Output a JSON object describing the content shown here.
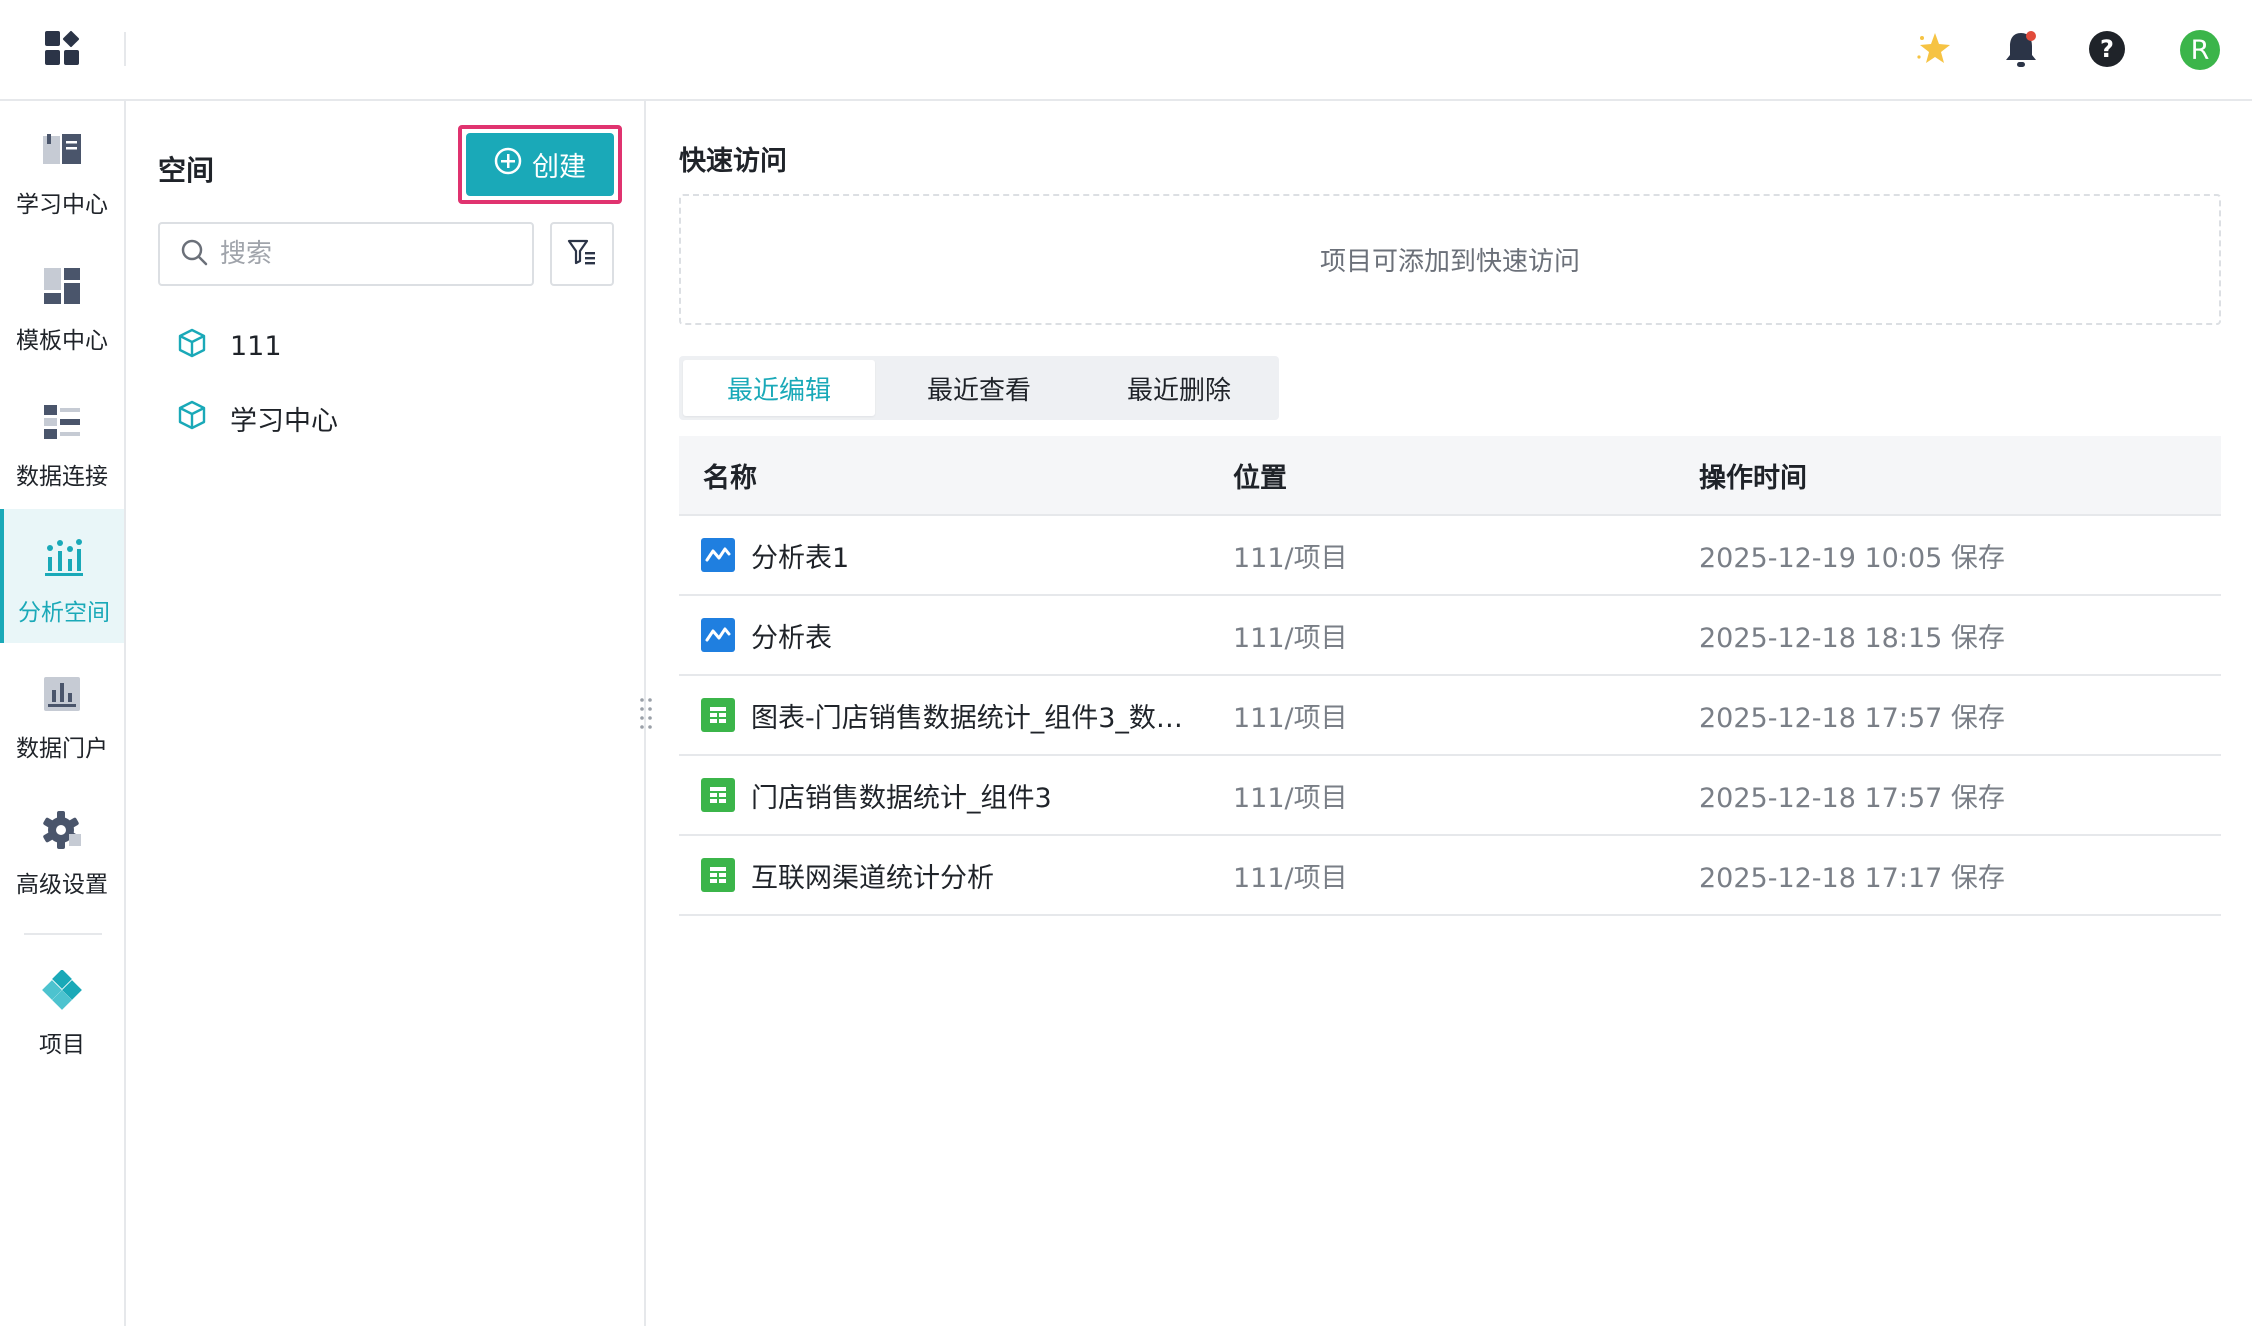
{
  "topbar": {
    "avatar_letter": "R"
  },
  "nav": {
    "items": [
      {
        "label": "学习中心"
      },
      {
        "label": "模板中心"
      },
      {
        "label": "数据连接"
      },
      {
        "label": "分析空间"
      },
      {
        "label": "数据门户"
      },
      {
        "label": "高级设置"
      },
      {
        "label": "项目"
      }
    ]
  },
  "space": {
    "title": "空间",
    "create_label": "创建",
    "search_placeholder": "搜索",
    "items": [
      {
        "label": "111"
      },
      {
        "label": "学习中心"
      }
    ]
  },
  "main": {
    "quick_title": "快速访问",
    "quick_empty": "项目可添加到快速访问",
    "tabs": [
      {
        "label": "最近编辑"
      },
      {
        "label": "最近查看"
      },
      {
        "label": "最近删除"
      }
    ],
    "columns": {
      "name": "名称",
      "location": "位置",
      "time": "操作时间"
    },
    "rows": [
      {
        "name": "分析表1",
        "location": "111/项目",
        "time": "2025-12-19 10:05 保存",
        "type": "analysis"
      },
      {
        "name": "分析表",
        "location": "111/项目",
        "time": "2025-12-18 18:15 保存",
        "type": "analysis"
      },
      {
        "name": "图表-门店销售数据统计_组件3_数…",
        "location": "111/项目",
        "time": "2025-12-18 17:57 保存",
        "type": "sheet"
      },
      {
        "name": "门店销售数据统计_组件3",
        "location": "111/项目",
        "time": "2025-12-18 17:57 保存",
        "type": "sheet"
      },
      {
        "name": "互联网渠道统计分析",
        "location": "111/项目",
        "time": "2025-12-18 17:17 保存",
        "type": "sheet"
      }
    ]
  },
  "colors": {
    "accent": "#1aa9b8",
    "highlight": "#e0336f",
    "analysis_icon": "#1f7fe0",
    "sheet_icon": "#3bb54a"
  }
}
